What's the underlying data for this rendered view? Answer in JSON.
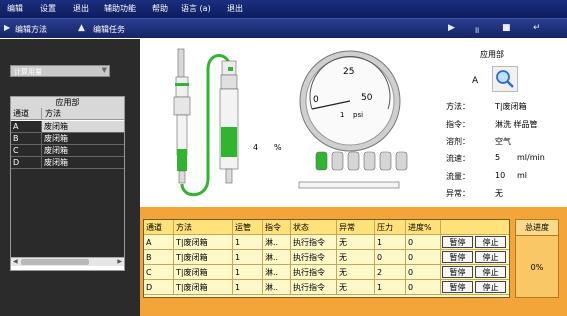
{
  "menu": [
    "编辑",
    "设置",
    "退出",
    "辅助功能",
    "帮助",
    "语言 (a)",
    "退出"
  ],
  "toolbar": {
    "edit_method": "编辑方法",
    "edit_task": "编辑任务",
    "icons": [
      "play-icon",
      "pause-icon",
      "stop-icon",
      "return-icon"
    ]
  },
  "left": {
    "combo_value": "计算用量",
    "grid_title": "应用部",
    "col_channel": "通道",
    "col_method": "方法",
    "rows": [
      {
        "ch": "A",
        "method": "废闭箱"
      },
      {
        "ch": "B",
        "method": "废闭箱"
      },
      {
        "ch": "C",
        "method": "废闭箱"
      },
      {
        "ch": "D",
        "method": "废闭箱"
      }
    ]
  },
  "illustration": {
    "percent_value": "4",
    "percent_unit": "%",
    "gauge_numbers": [
      "25",
      "0",
      "50"
    ],
    "gauge_unit_1": "1",
    "gauge_unit_2": "psi"
  },
  "info": {
    "title": "应用部",
    "channel": "A",
    "method_label": "方法：",
    "method_value": "T|废闭箱",
    "cmd_label": "指令：",
    "cmd_value": "淋洗 样品管",
    "solvent_label": "溶剂：",
    "solvent_value": "空气",
    "flow_label": "流速：",
    "flow_value": "5",
    "flow_unit": "ml/min",
    "volume_label": "流量：",
    "volume_value": "10",
    "volume_unit": "ml",
    "abnormal_label": "异常：",
    "abnormal_value": "无"
  },
  "table": {
    "headers": [
      "通道",
      "方法",
      "运管",
      "指令",
      "状态",
      "异常",
      "压力",
      "进度%"
    ],
    "rows": [
      {
        "ch": "A",
        "method": "T|废闭箱",
        "tube": "1",
        "cmd": "淋..",
        "status": "执行指令",
        "abn": "无",
        "pressure": "1",
        "progress": "0"
      },
      {
        "ch": "B",
        "method": "T|废闭箱",
        "tube": "1",
        "cmd": "淋..",
        "status": "执行指令",
        "abn": "无",
        "pressure": "0",
        "progress": "0"
      },
      {
        "ch": "C",
        "method": "T|废闭箱",
        "tube": "1",
        "cmd": "淋..",
        "status": "执行指令",
        "abn": "无",
        "pressure": "2",
        "progress": "0"
      },
      {
        "ch": "D",
        "method": "T|废闭箱",
        "tube": "1",
        "cmd": "淋..",
        "status": "执行指令",
        "abn": "无",
        "pressure": "1",
        "progress": "0"
      }
    ],
    "pause_label": "暂停",
    "stop_label": "停止"
  },
  "progress": {
    "header": "总进度",
    "value": "0%"
  },
  "colors": {
    "accent_green": "#2fb52f",
    "bottom_orange": "#f4a53a",
    "menubar_blue": "#13246a"
  }
}
